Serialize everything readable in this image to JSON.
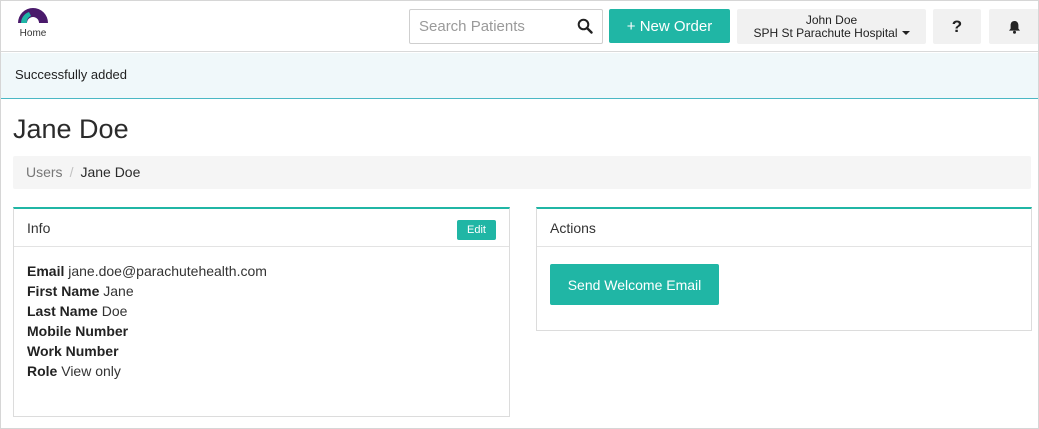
{
  "header": {
    "home_label": "Home",
    "search": {
      "placeholder": "Search Patients",
      "value": ""
    },
    "new_order_label": "+ New Order",
    "user": {
      "name": "John Doe",
      "organization": "SPH St Parachute Hospital"
    },
    "help_label": "?",
    "icons": {
      "logo": "parachute-logo-icon",
      "search": "search-icon",
      "bell": "bell-icon"
    }
  },
  "flash": {
    "message": "Successfully added"
  },
  "page": {
    "title": "Jane Doe",
    "breadcrumb": [
      {
        "label": "Users"
      },
      {
        "label": "Jane Doe"
      }
    ]
  },
  "info_panel": {
    "title": "Info",
    "edit_label": "Edit",
    "fields": [
      {
        "label": "Email",
        "value": "jane.doe@parachutehealth.com"
      },
      {
        "label": "First Name",
        "value": "Jane"
      },
      {
        "label": "Last Name",
        "value": "Doe"
      },
      {
        "label": "Mobile Number",
        "value": ""
      },
      {
        "label": "Work Number",
        "value": ""
      },
      {
        "label": "Role",
        "value": "View only"
      }
    ]
  },
  "actions_panel": {
    "title": "Actions",
    "send_welcome_label": "Send Welcome Email"
  },
  "colors": {
    "accent": "#20b6a5",
    "flash_border": "#4bb8c4",
    "logo_purple": "#4a1a6b"
  }
}
